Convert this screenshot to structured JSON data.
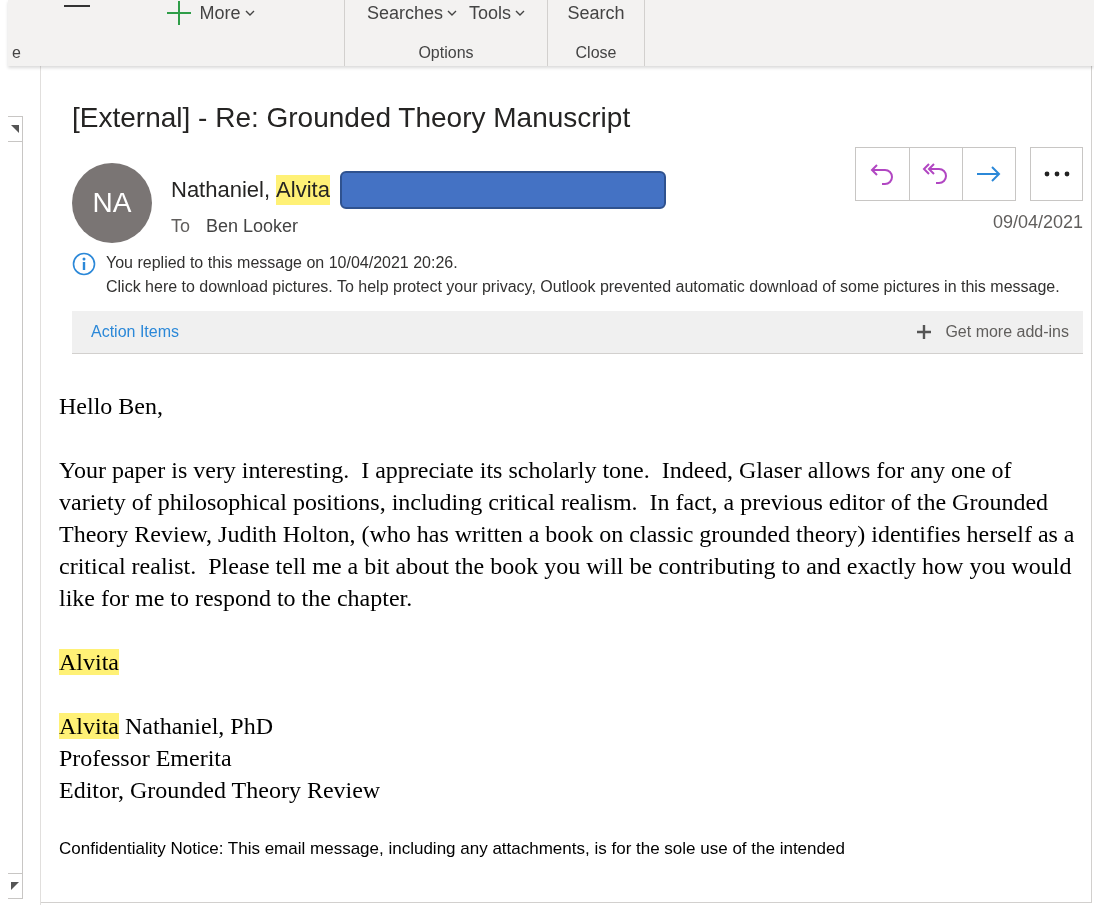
{
  "ribbon": {
    "groups": [
      {
        "label": "e",
        "commands": [
          {
            "label": "More",
            "kind": "add"
          }
        ]
      },
      {
        "label": "Options",
        "commands": [
          {
            "label": "Searches",
            "kind": "dropdown"
          },
          {
            "label": "Tools",
            "kind": "dropdown"
          }
        ]
      },
      {
        "label": "Close",
        "commands": [
          {
            "label": "Search",
            "kind": "plain"
          }
        ]
      }
    ]
  },
  "message": {
    "subject": "[External] - Re: Grounded Theory Manuscript",
    "avatar_initials": "NA",
    "sender": [
      {
        "text": "Nathaniel,",
        "highlighted": false
      },
      {
        "text": "Alvita",
        "highlighted": true
      }
    ],
    "sender_redacted": true,
    "to_label": "To",
    "recipient": "Ben Looker",
    "date": "09/04/2021",
    "actions": [
      {
        "kind": "reply"
      },
      {
        "kind": "reply_all"
      },
      {
        "kind": "forward"
      },
      {
        "kind": "more"
      }
    ],
    "info_lines": [
      "You replied to this message on 10/04/2021 20:26.",
      "Click here to download pictures. To help protect your privacy, Outlook prevented automatic download of some pictures in this message."
    ],
    "addins": {
      "left": "Action Items",
      "right": "Get more add-ins"
    },
    "body": [
      {
        "lines": [
          [
            {
              "text": "Hello Ben,",
              "highlighted": false
            }
          ]
        ]
      },
      {
        "lines": [
          [
            {
              "text": "Your paper is very interesting.  I appreciate its scholarly tone.  Indeed, Glaser allows for any one of variety of philosophical positions, including critical realism.  In fact, a previous editor of the Grounded Theory Review, Judith Holton, (who has written a book on classic grounded theory) identifies herself as a critical realist.  Please tell me a bit about the book you will be contributing to and exactly how you would like for me to respond to the chapter.",
              "highlighted": false
            }
          ]
        ]
      },
      {
        "lines": [
          [
            {
              "text": "Alvita",
              "highlighted": true
            }
          ]
        ]
      },
      {
        "lines": [
          [
            {
              "text": "Alvita",
              "highlighted": true
            },
            {
              "text": " Nathaniel, PhD",
              "highlighted": false
            }
          ],
          [
            {
              "text": "Professor Emerita",
              "highlighted": false
            }
          ],
          [
            {
              "text": "Editor, Grounded Theory Review",
              "highlighted": false
            }
          ]
        ]
      }
    ],
    "notice": "Confidentiality Notice: This email message, including any attachments, is for the sole use of the intended"
  }
}
